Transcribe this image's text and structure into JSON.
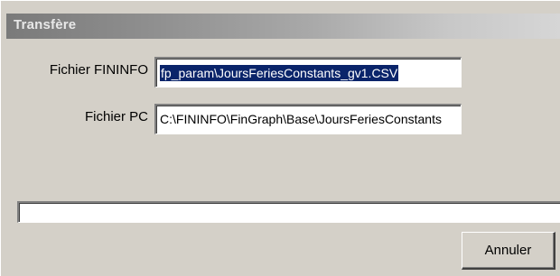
{
  "window": {
    "title": "Transfère"
  },
  "form": {
    "finfo_label": "Fichier FININFO",
    "finfo_value": "fp_param\\JoursFeriesConstants_gv1.CSV",
    "pc_label": "Fichier PC",
    "pc_value": "C:\\FININFO\\FinGraph\\Base\\JoursFeriesConstants"
  },
  "progress": {
    "value_percent": 0
  },
  "buttons": {
    "cancel_label": "Annuler"
  },
  "colors": {
    "dialog_background": "#d4d0c8",
    "selection_background": "#0a246a",
    "selection_text": "#ffffff",
    "title_bar_start": "#7a7a7a",
    "title_bar_end": "#d6d6d6"
  }
}
